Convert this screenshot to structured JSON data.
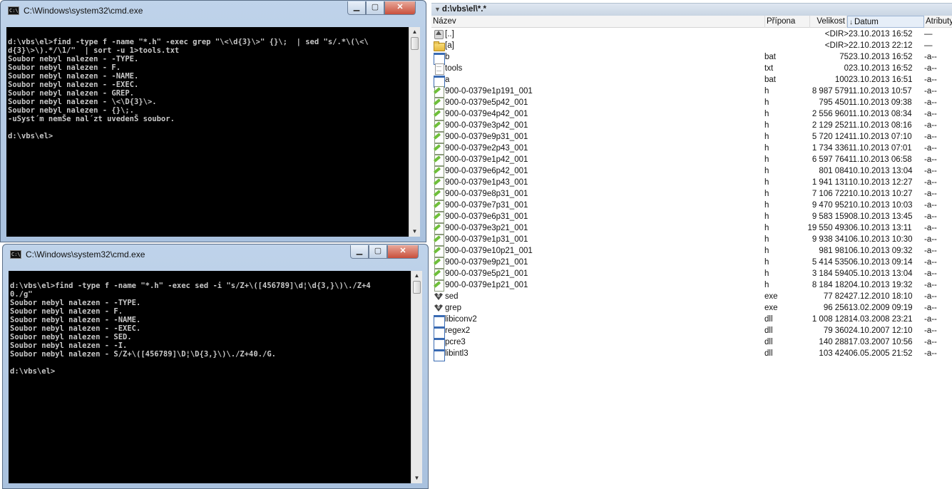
{
  "cmd_top": {
    "title": "C:\\Windows\\system32\\cmd.exe",
    "icon_text": "C:\\",
    "buttons": {
      "minimize": "▁",
      "maximize": "▢",
      "close": "✕"
    },
    "lines": [
      "",
      "d:\\vbs\\el>find -type f -name \"*.h\" -exec grep \"\\<\\d{3}\\>\" {}\\;  | sed \"s/.*\\(\\<\\",
      "d{3}\\>\\).*/\\1/\"  | sort -u 1>tools.txt",
      "Soubor nebyl nalezen - -TYPE.",
      "Soubor nebyl nalezen - F.",
      "Soubor nebyl nalezen - -NAME.",
      "Soubor nebyl nalezen - -EXEC.",
      "Soubor nebyl nalezen - GREP.",
      "Soubor nebyl nalezen - \\<\\D{3}\\>.",
      "Soubor nebyl nalezen - {}\\;.",
      "-uSyst´m nemŠe nal´zt uvedenŠ soubor.",
      "",
      "d:\\vbs\\el>"
    ]
  },
  "cmd_bottom": {
    "title": "C:\\Windows\\system32\\cmd.exe",
    "icon_text": "C:\\",
    "buttons": {
      "minimize": "▁",
      "maximize": "▢",
      "close": "✕"
    },
    "lines": [
      "",
      "d:\\vbs\\el>find -type f -name \"*.h\" -exec sed -i \"s/Z+\\([456789]\\d¦\\d{3,}\\)\\./Z+4",
      "0./g\"",
      "Soubor nebyl nalezen - -TYPE.",
      "Soubor nebyl nalezen - F.",
      "Soubor nebyl nalezen - -NAME.",
      "Soubor nebyl nalezen - -EXEC.",
      "Soubor nebyl nalezen - SED.",
      "Soubor nebyl nalezen - -I.",
      "Soubor nebyl nalezen - S/Z+\\([456789]\\D¦\\D{3,}\\)\\./Z+40./G.",
      "",
      "d:\\vbs\\el>"
    ]
  },
  "panel": {
    "path": "d:\\vbs\\el\\*.*",
    "columns": {
      "name": "Název",
      "ext": "Přípona",
      "size": "Velikost",
      "date": "Datum",
      "attr": "Atributy"
    },
    "sort_icon": "↓",
    "files": [
      {
        "icon": "up-icon",
        "name": "[..]",
        "ext": "",
        "size": "<DIR>",
        "date": "23.10.2013 16:52",
        "attr": "—"
      },
      {
        "icon": "folder-icon",
        "name": "[a]",
        "ext": "",
        "size": "<DIR>",
        "date": "22.10.2013 22:12",
        "attr": "—"
      },
      {
        "icon": "window-icon",
        "name": "b",
        "ext": "bat",
        "size": "75",
        "date": "23.10.2013 16:52",
        "attr": "-a--"
      },
      {
        "icon": "document-icon",
        "name": "tools",
        "ext": "txt",
        "size": "0",
        "date": "23.10.2013 16:52",
        "attr": "-a--"
      },
      {
        "icon": "window-icon",
        "name": "a",
        "ext": "bat",
        "size": "100",
        "date": "23.10.2013 16:51",
        "attr": "-a--"
      },
      {
        "icon": "header-file-icon",
        "name": "900-0-0379e1p191_001",
        "ext": "h",
        "size": "8 987 579",
        "date": "11.10.2013 10:57",
        "attr": "-a--"
      },
      {
        "icon": "header-file-icon",
        "name": "900-0-0379e5p42_001",
        "ext": "h",
        "size": "795 450",
        "date": "11.10.2013 09:38",
        "attr": "-a--"
      },
      {
        "icon": "header-file-icon",
        "name": "900-0-0379e4p42_001",
        "ext": "h",
        "size": "2 556 960",
        "date": "11.10.2013 08:34",
        "attr": "-a--"
      },
      {
        "icon": "header-file-icon",
        "name": "900-0-0379e3p42_001",
        "ext": "h",
        "size": "2 129 252",
        "date": "11.10.2013 08:16",
        "attr": "-a--"
      },
      {
        "icon": "header-file-icon",
        "name": "900-0-0379e9p31_001",
        "ext": "h",
        "size": "5 720 124",
        "date": "11.10.2013 07:10",
        "attr": "-a--"
      },
      {
        "icon": "header-file-icon",
        "name": "900-0-0379e2p43_001",
        "ext": "h",
        "size": "1 734 336",
        "date": "11.10.2013 07:01",
        "attr": "-a--"
      },
      {
        "icon": "header-file-icon",
        "name": "900-0-0379e1p42_001",
        "ext": "h",
        "size": "6 597 764",
        "date": "11.10.2013 06:58",
        "attr": "-a--"
      },
      {
        "icon": "header-file-icon",
        "name": "900-0-0379e6p42_001",
        "ext": "h",
        "size": "801 084",
        "date": "10.10.2013 13:04",
        "attr": "-a--"
      },
      {
        "icon": "header-file-icon",
        "name": "900-0-0379e1p43_001",
        "ext": "h",
        "size": "1 941 131",
        "date": "10.10.2013 12:27",
        "attr": "-a--"
      },
      {
        "icon": "header-file-icon",
        "name": "900-0-0379e8p31_001",
        "ext": "h",
        "size": "7 106 722",
        "date": "10.10.2013 10:27",
        "attr": "-a--"
      },
      {
        "icon": "header-file-icon",
        "name": "900-0-0379e7p31_001",
        "ext": "h",
        "size": "9 470 952",
        "date": "10.10.2013 10:03",
        "attr": "-a--"
      },
      {
        "icon": "header-file-icon",
        "name": "900-0-0379e6p31_001",
        "ext": "h",
        "size": "9 583 159",
        "date": "08.10.2013 13:45",
        "attr": "-a--"
      },
      {
        "icon": "header-file-icon",
        "name": "900-0-0379e3p21_001",
        "ext": "h",
        "size": "19 550 493",
        "date": "06.10.2013 13:11",
        "attr": "-a--"
      },
      {
        "icon": "header-file-icon",
        "name": "900-0-0379e1p31_001",
        "ext": "h",
        "size": "9 938 341",
        "date": "06.10.2013 10:30",
        "attr": "-a--"
      },
      {
        "icon": "header-file-icon",
        "name": "900-0-0379e10p21_001",
        "ext": "h",
        "size": "981 981",
        "date": "06.10.2013 09:32",
        "attr": "-a--"
      },
      {
        "icon": "header-file-icon",
        "name": "900-0-0379e9p21_001",
        "ext": "h",
        "size": "5 414 535",
        "date": "06.10.2013 09:14",
        "attr": "-a--"
      },
      {
        "icon": "header-file-icon",
        "name": "900-0-0379e5p21_001",
        "ext": "h",
        "size": "3 184 594",
        "date": "05.10.2013 13:04",
        "attr": "-a--"
      },
      {
        "icon": "header-file-icon",
        "name": "900-0-0379e1p21_001",
        "ext": "h",
        "size": "8 184 182",
        "date": "04.10.2013 19:32",
        "attr": "-a--"
      },
      {
        "icon": "executable-icon",
        "name": "sed",
        "ext": "exe",
        "size": "77 824",
        "date": "27.12.2010 18:10",
        "attr": "-a--"
      },
      {
        "icon": "executable-icon",
        "name": "grep",
        "ext": "exe",
        "size": "96 256",
        "date": "13.02.2009 09:19",
        "attr": "-a--"
      },
      {
        "icon": "window-icon",
        "name": "libiconv2",
        "ext": "dll",
        "size": "1 008 128",
        "date": "14.03.2008 23:21",
        "attr": "-a--"
      },
      {
        "icon": "window-icon",
        "name": "regex2",
        "ext": "dll",
        "size": "79 360",
        "date": "24.10.2007 12:10",
        "attr": "-a--"
      },
      {
        "icon": "window-icon",
        "name": "pcre3",
        "ext": "dll",
        "size": "140 288",
        "date": "17.03.2007 10:56",
        "attr": "-a--"
      },
      {
        "icon": "window-icon",
        "name": "libintl3",
        "ext": "dll",
        "size": "103 424",
        "date": "06.05.2005 21:52",
        "attr": "-a--"
      }
    ]
  }
}
